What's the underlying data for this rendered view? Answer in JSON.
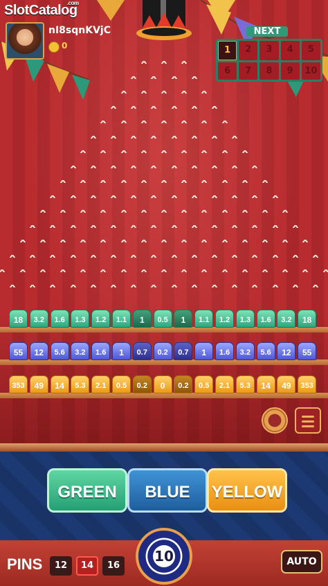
{
  "header": {
    "logo_main": "SlotCatalog",
    "logo_tld": ".com",
    "username": "nI8sqnKVjC",
    "balance": "0"
  },
  "next_panel": {
    "title": "NEXT",
    "numbers": [
      "1",
      "2",
      "3",
      "4",
      "5",
      "6",
      "7",
      "8",
      "9",
      "10"
    ],
    "active_index": 0
  },
  "multipliers": {
    "green": [
      "18",
      "3.2",
      "1.6",
      "1.3",
      "1.2",
      "1.1",
      "1",
      "0.5",
      "1",
      "1.1",
      "1.2",
      "1.3",
      "1.6",
      "3.2",
      "18"
    ],
    "blue": [
      "55",
      "12",
      "5.6",
      "3.2",
      "1.6",
      "1",
      "0.7",
      "0.2",
      "0.7",
      "1",
      "1.6",
      "3.2",
      "5.6",
      "12",
      "55"
    ],
    "yellow": [
      "353",
      "49",
      "14",
      "5.3",
      "2.1",
      "0.5",
      "0.2",
      "0",
      "0.2",
      "0.5",
      "2.1",
      "5.3",
      "14",
      "49",
      "353"
    ],
    "highlighted_indexes": [
      6,
      8
    ]
  },
  "color_buttons": {
    "green": "GREEN",
    "blue": "BLUE",
    "yellow": "YELLOW"
  },
  "controls": {
    "pins_label": "PINS",
    "pin_options": [
      "12",
      "14",
      "16"
    ],
    "pin_selected_index": 1,
    "bet_value": "10",
    "auto_label": "AUTO"
  },
  "colors": {
    "board_red": "#b82c30",
    "green": "#2ea780",
    "blue": "#4e57d6",
    "yellow": "#eb9a16",
    "navy": "#172b58"
  },
  "icons": [
    "settings-gear-icon",
    "menu-icon",
    "coin-icon"
  ]
}
